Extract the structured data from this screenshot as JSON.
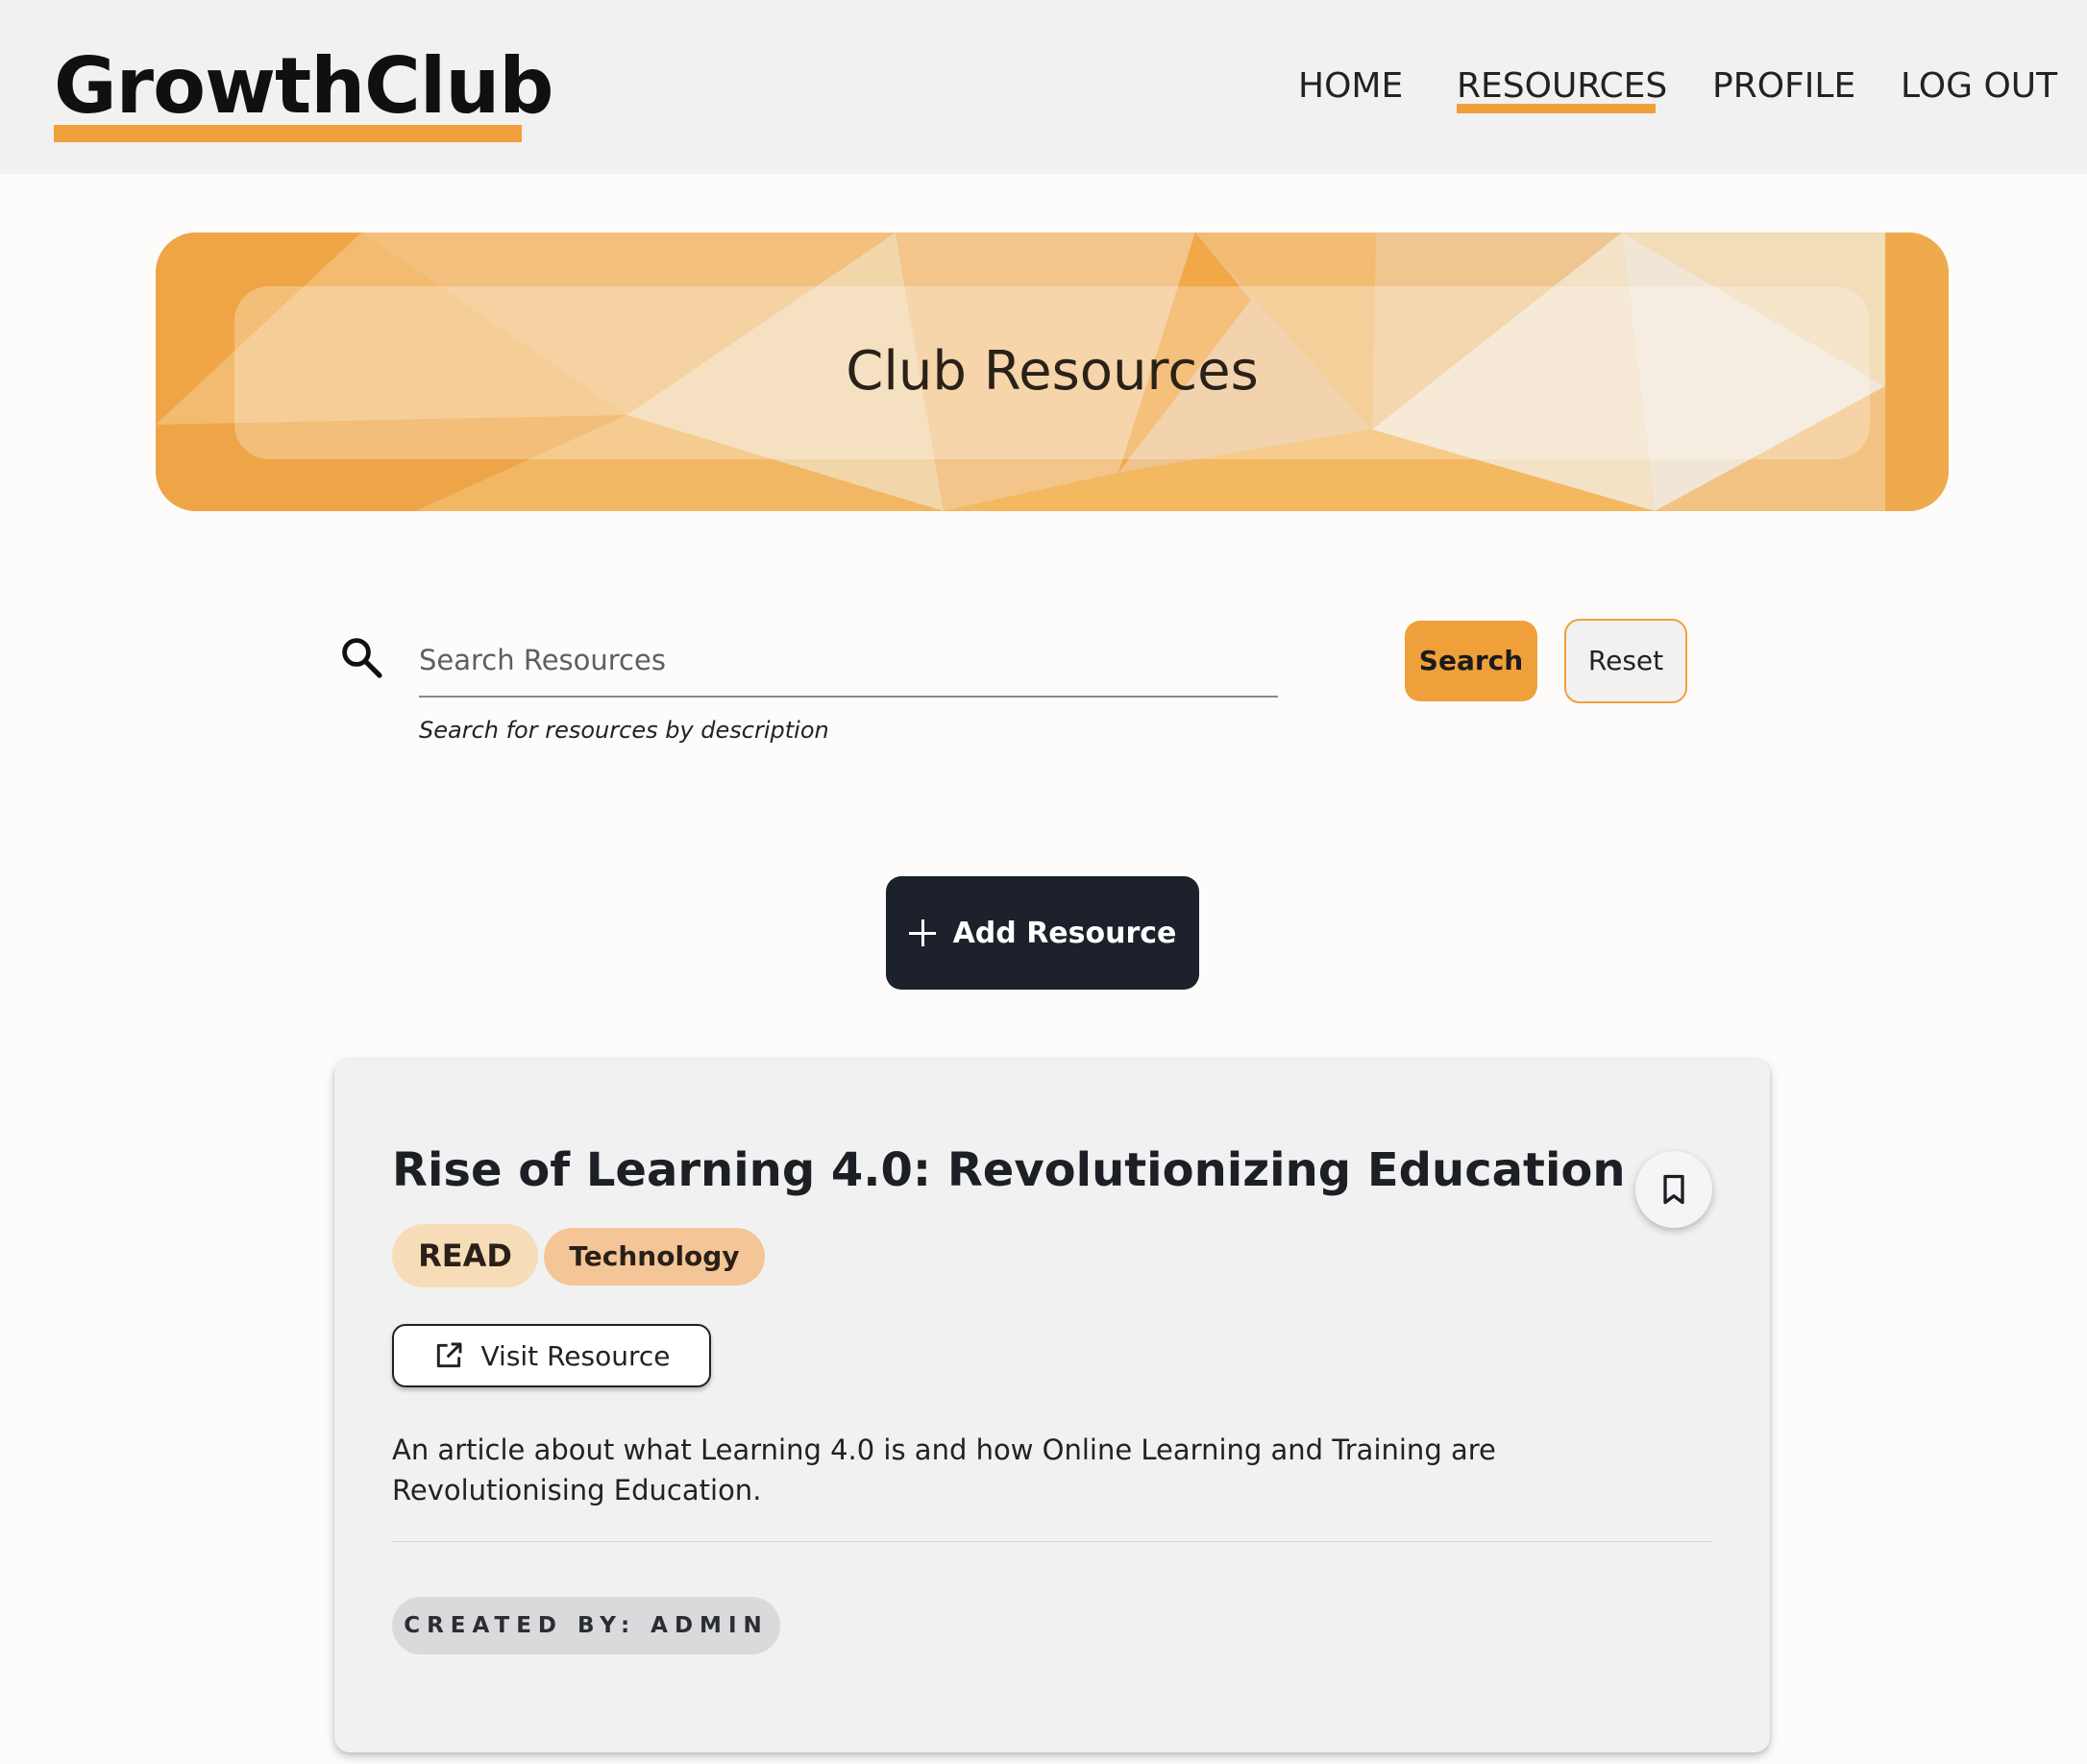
{
  "header": {
    "logo": "GrowthClub",
    "nav": [
      {
        "label": "HOME"
      },
      {
        "label": "RESOURCES",
        "active": true
      },
      {
        "label": "PROFILE"
      },
      {
        "label": "LOG OUT"
      }
    ]
  },
  "banner": {
    "title": "Club Resources"
  },
  "search": {
    "placeholder": "Search Resources",
    "helper": "Search for resources by description",
    "search_label": "Search",
    "reset_label": "Reset"
  },
  "actions": {
    "add_label": "Add Resource"
  },
  "resource": {
    "title": "Rise of Learning 4.0: Revolutionizing Education",
    "type_tag": "READ",
    "category_tag": "Technology",
    "visit_label": "Visit Resource",
    "description": "An article about what Learning 4.0 is and how Online Learning and Training are Revolutionising Education.",
    "created_by": "CREATED BY: ADMIN"
  },
  "colors": {
    "accent": "#f0a03a",
    "dark_button": "#1c212b",
    "header_bg": "#f1f1f2",
    "card_bg": "#f1f1f2"
  },
  "icons": {
    "search": "search-icon",
    "add": "plus-icon",
    "visit": "external-link-icon",
    "bookmark": "bookmark-icon"
  }
}
